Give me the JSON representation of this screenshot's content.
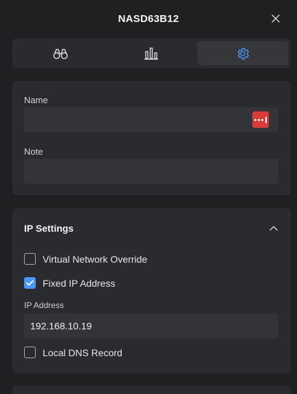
{
  "header": {
    "title": "NASD63B12"
  },
  "tabs": [
    {
      "icon": "binoculars-icon",
      "active": false
    },
    {
      "icon": "bar-chart-icon",
      "active": false
    },
    {
      "icon": "gear-icon",
      "active": true
    }
  ],
  "general": {
    "name_label": "Name",
    "name_value": "",
    "note_label": "Note",
    "note_value": ""
  },
  "ip_settings": {
    "title": "IP Settings",
    "virtual_network_override": {
      "label": "Virtual Network Override",
      "checked": false
    },
    "fixed_ip": {
      "label": "Fixed IP Address",
      "checked": true
    },
    "ip_address_label": "IP Address",
    "ip_address_value": "192.168.10.19",
    "local_dns": {
      "label": "Local DNS Record",
      "checked": false
    }
  },
  "colors": {
    "accent": "#4797ff",
    "password_manager": "#d93a3a",
    "background": "#1f2022",
    "card": "#2a2b2e"
  }
}
